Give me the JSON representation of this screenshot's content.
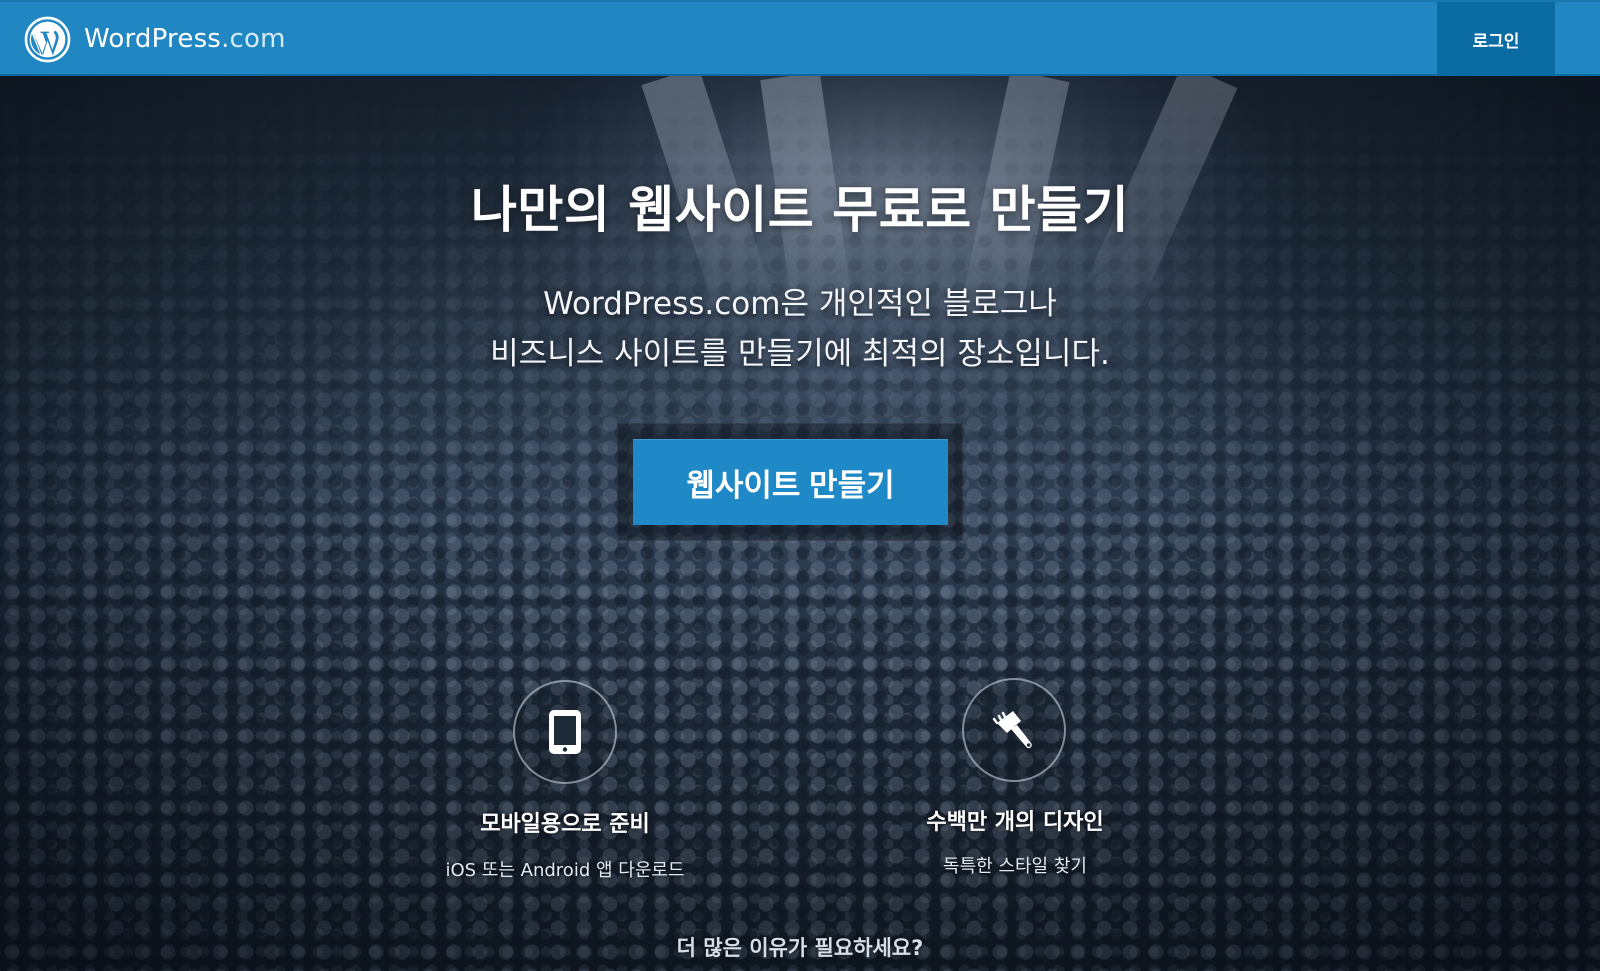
{
  "header": {
    "brand_name": "WordPress",
    "brand_tld": ".com",
    "logo_icon": "wordpress-logo-icon",
    "login_label": "로그인"
  },
  "hero": {
    "headline": "나만의 웹사이트 무료로 만들기",
    "subline_1": "WordPress.com은 개인적인 블로그나",
    "subline_2": "비즈니스 사이트를 만들기에 최적의 장소입니다.",
    "cta_label": "웹사이트 만들기"
  },
  "features": [
    {
      "icon": "mobile-icon",
      "title": "모바일용으로 준비",
      "subtitle": "iOS 또는 Android 앱 다운로드"
    },
    {
      "icon": "paintbrush-icon",
      "title": "수백만 개의 디자인",
      "subtitle": "독특한 스타일 찾기"
    }
  ],
  "more_link": "더 많은 이유가 필요하세요?",
  "colors": {
    "brand_blue": "#2087c2",
    "login_bg": "#0b6ba3",
    "cta_blue": "#1f88c6"
  }
}
